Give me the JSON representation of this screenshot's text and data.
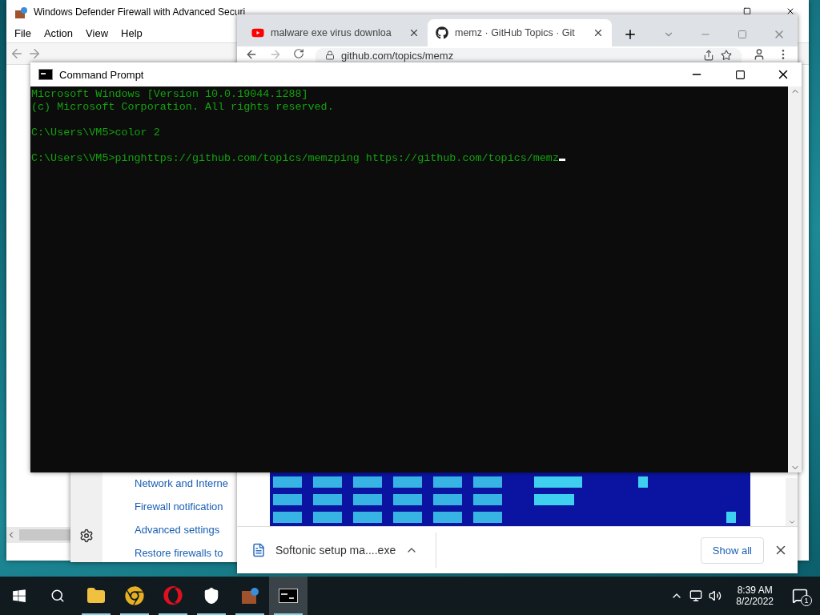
{
  "firewall_window": {
    "title": "Windows Defender Firewall with Advanced Securi",
    "menu": [
      "File",
      "Action",
      "View",
      "Help"
    ]
  },
  "control_panel": {
    "links": [
      "Network and Interne",
      "Firewall notification",
      "Advanced settings",
      "Restore firewalls to"
    ]
  },
  "browser": {
    "tabs": [
      {
        "kind": "video",
        "title": "malware exe virus downloa",
        "selected": false
      },
      {
        "kind": "code",
        "title": "memz · GitHub Topics · Git",
        "selected": true
      }
    ],
    "address": "github.com/topics/memz",
    "download": {
      "file": "Softonic setup ma....exe",
      "show_all": "Show all"
    }
  },
  "command_prompt": {
    "title": "Command Prompt",
    "blocks": [
      [
        "Microsoft Windows [Version 10.0.19044.1288]",
        "(c) Microsoft Corporation. All rights reserved."
      ],
      [
        "C:\\Users\\VM5>color 2"
      ],
      [
        "C:\\Users\\VM5>pinghttps://github.com/topics/memzping https://github.com/topics/memz"
      ]
    ]
  },
  "taskbar": {
    "apps": [
      {
        "kind": "folder",
        "selected": false
      },
      {
        "kind": "chrome",
        "selected": false
      },
      {
        "kind": "opera",
        "selected": false
      },
      {
        "kind": "shield",
        "selected": false
      },
      {
        "kind": "firewall",
        "selected": false
      },
      {
        "kind": "terminal",
        "selected": true
      }
    ],
    "time": "8:39 AM",
    "date": "8/2/2022",
    "notifications": "1"
  }
}
